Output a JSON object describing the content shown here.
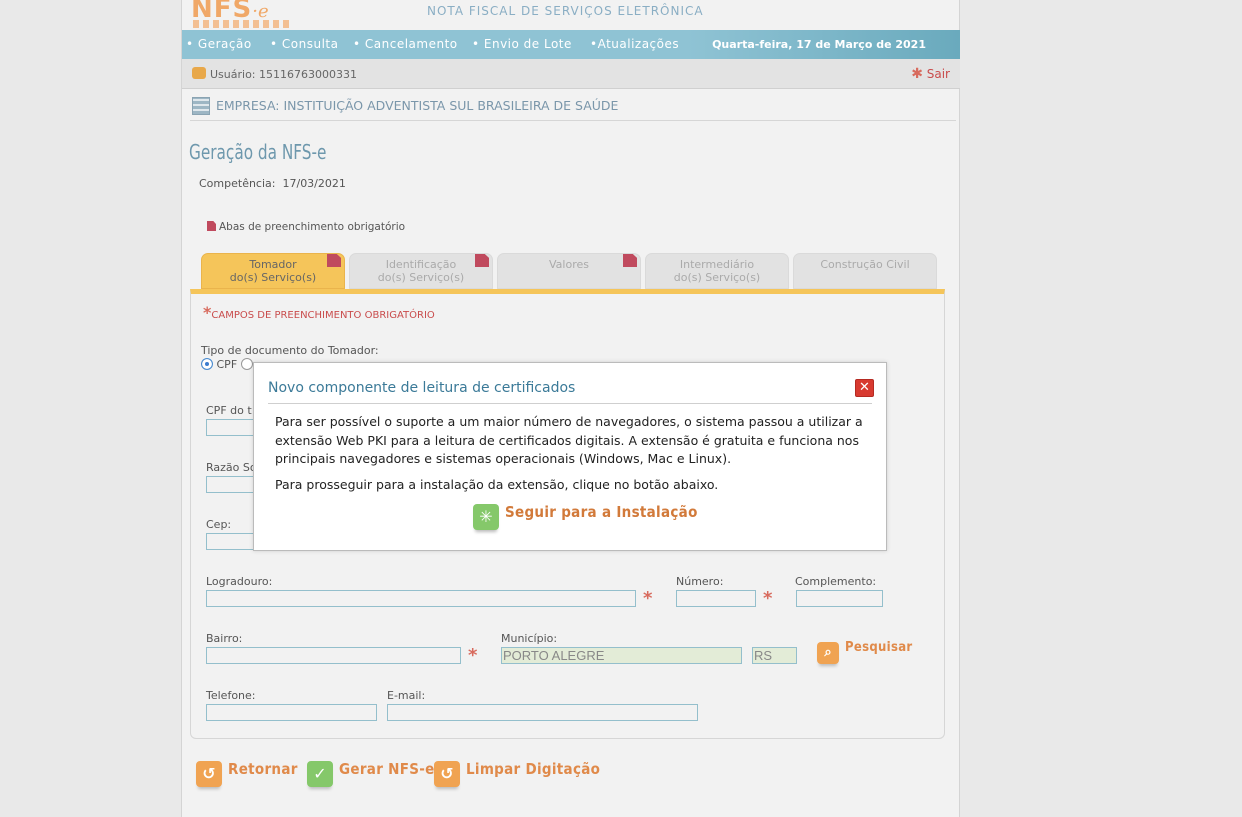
{
  "header": {
    "logo_text": "NFS",
    "logo_suffix": "e",
    "title": "NOTA FISCAL DE SERVIÇOS ELETRÔNICA"
  },
  "nav": {
    "items": [
      "• Geração",
      "• Consulta",
      "• Cancelamento",
      "• Envio de Lote",
      "•Atualizações"
    ],
    "date": "Quarta-feira, 17 de Março de 2021"
  },
  "user": {
    "label": "Usuário: 15116763000331",
    "logout": "Sair"
  },
  "company": "EMPRESA: INSTITUIÇÃO ADVENTISTA SUL BRASILEIRA DE SAÚDE",
  "page": {
    "title": "Geração da NFS-e",
    "competencia_label": "Competência:",
    "competencia_value": "17/03/2021",
    "legend": "Abas de preenchimento obrigatório"
  },
  "tabs": [
    {
      "line1": "Tomador",
      "line2": "do(s) Serviço(s)"
    },
    {
      "line1": "Identificação",
      "line2": "do(s) Serviço(s)"
    },
    {
      "line1": "Valores",
      "line2": ""
    },
    {
      "line1": "Intermediário",
      "line2": "do(s) Serviço(s)"
    },
    {
      "line1": "Construção Civil",
      "line2": ""
    }
  ],
  "form": {
    "required_note": "CAMPOS DE PREENCHIMENTO OBRIGATÓRIO",
    "doc_type_label": "Tipo de documento do Tomador:",
    "radio_cpf": "CPF",
    "cpf_label": "CPF do t",
    "razao_label": "Razão So",
    "cep_label": "Cep:",
    "logradouro_label": "Logradouro:",
    "numero_label": "Número:",
    "complemento_label": "Complemento:",
    "bairro_label": "Bairro:",
    "municipio_label": "Município:",
    "municipio_value": "PORTO ALEGRE",
    "uf_value": "RS",
    "search_label": "Pesquisar",
    "telefone_label": "Telefone:",
    "email_label": "E-mail:"
  },
  "actions": {
    "back": "Retornar",
    "generate": "Gerar NFS-e",
    "clear": "Limpar Digitação"
  },
  "modal": {
    "title": "Novo componente de leitura de certificados",
    "paragraph1": "Para ser possível o suporte a um maior número de navegadores, o sistema passou a utilizar a extensão Web PKI para a leitura de certificados digitais. A extensão é gratuita e funciona nos principais navegadores e sistemas operacionais (Windows, Mac e Linux).",
    "paragraph2": "Para prosseguir para a instalação da extensão, clique no botão abaixo.",
    "install_button": "Seguir para a Instalação"
  }
}
